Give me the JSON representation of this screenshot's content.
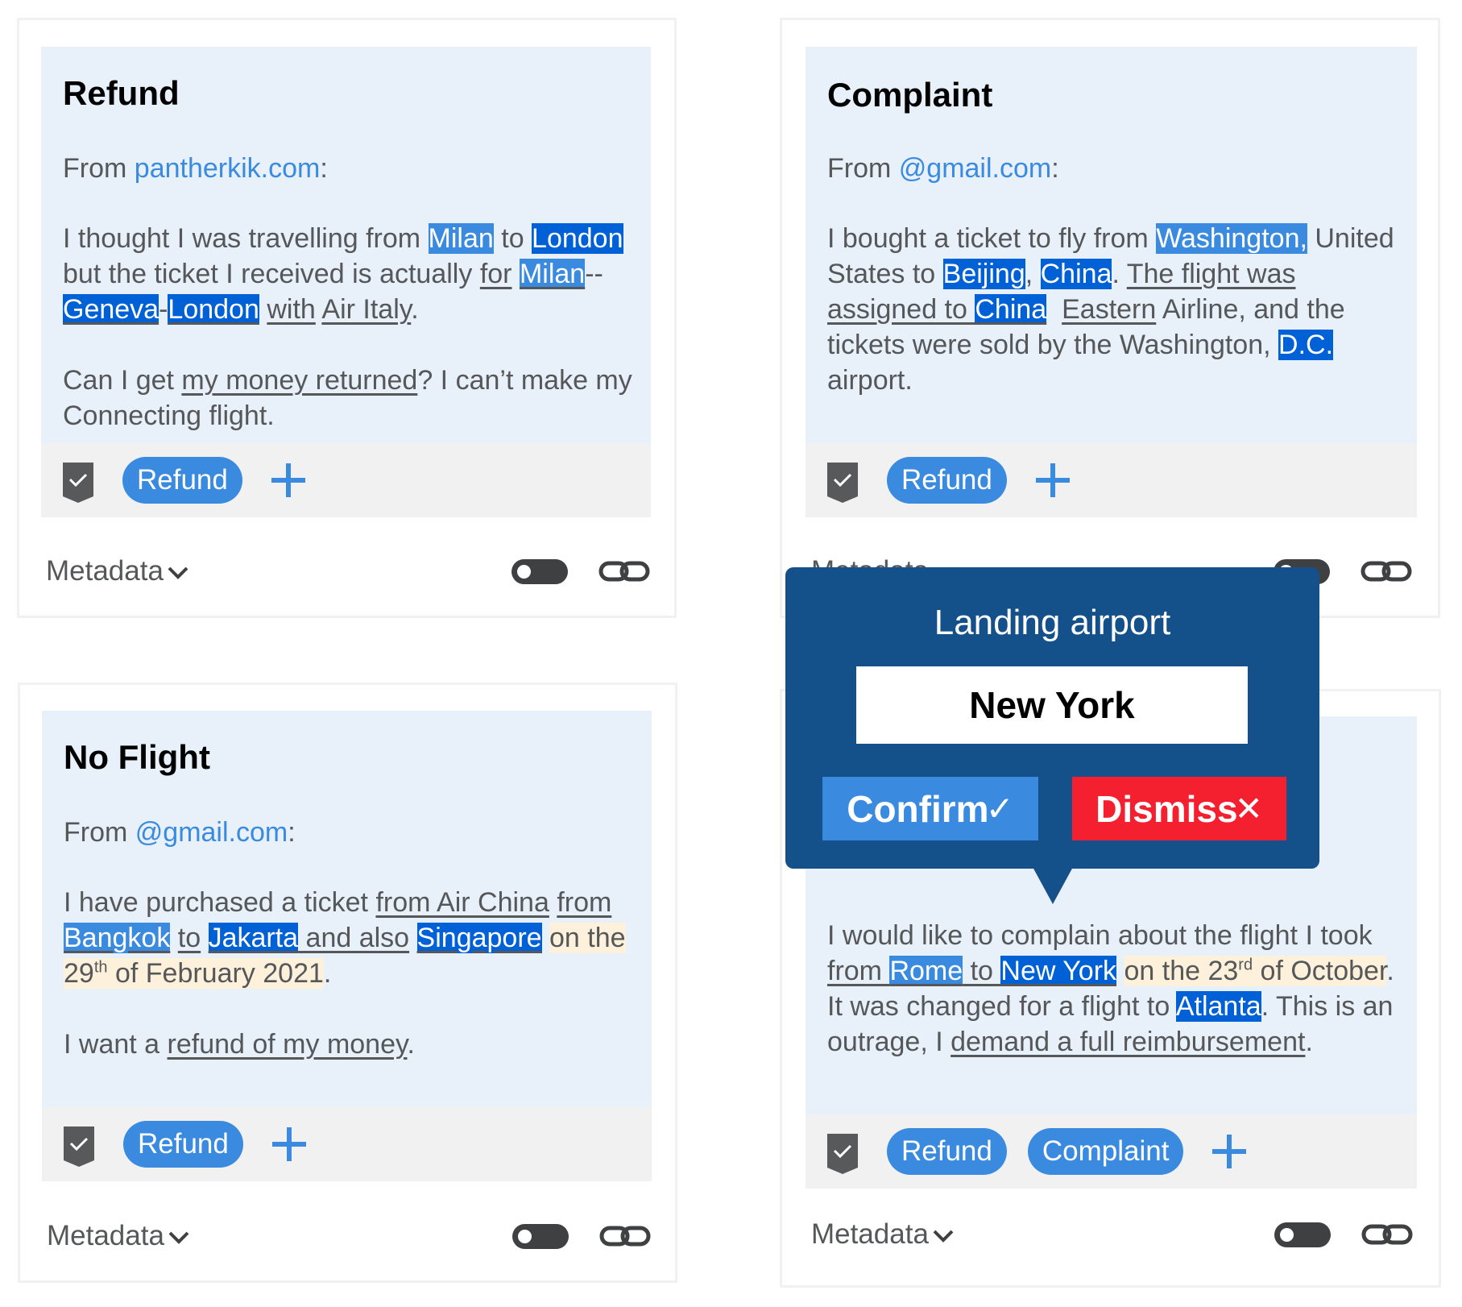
{
  "colors": {
    "accent": "#3a8be0",
    "entity_dark": "#0060d6",
    "date_highlight": "#fdf1dc",
    "panel_bg": "#e8f0fa",
    "popup_bg": "#14508a",
    "dismiss": "#f5202f"
  },
  "cards": [
    {
      "title": "Refund",
      "from_label": "From ",
      "from_email": "pantherkik.com",
      "from_suffix": ":",
      "labels": [
        "Refund"
      ],
      "metadata_label": "Metadata",
      "toggle_on": false
    },
    {
      "title": "Complaint",
      "from_label": "From ",
      "from_email": "@gmail.com",
      "from_suffix": ":",
      "labels": [
        "Refund"
      ],
      "metadata_label": "Metadata",
      "toggle_on": false
    },
    {
      "title": "No Flight",
      "from_label": "From ",
      "from_email": "@gmail.com",
      "from_suffix": ":",
      "labels": [
        "Refund"
      ],
      "metadata_label": "Metadata",
      "toggle_on": false
    },
    {
      "title": "",
      "labels": [
        "Refund",
        "Complaint"
      ],
      "metadata_label": "Metadata",
      "toggle_on": false
    }
  ],
  "text": {
    "c1": {
      "t1": "I thought I was travelling from ",
      "milan1": "Milan",
      "t2": " to ",
      "london1": "London ",
      "t3": "but the ticket I received is actually ",
      "for": "for",
      "sp1": " ",
      "milan2": "Milan",
      "dash1": "--",
      "geneva": "Geneva",
      "dash2": "-",
      "london2": "London",
      "sp2": " ",
      "with": "with",
      "sp3": " ",
      "airitaly": "Air Italy",
      "dot": ".",
      "p2a": "Can I get ",
      "money": "my money returned",
      "p2b": "? I can’t make my Connecting flight."
    },
    "c2": {
      "t1": "I bought a ticket to fly from ",
      "wash": "Washington,",
      "t2": " United States to ",
      "beijing": "Beijing",
      "comma": ", ",
      "china1": "China",
      "dot1": ". ",
      "flight": "The flight was assigned to ",
      "china2": "China",
      "sp": "  ",
      "eastern": "Eastern",
      "t3": " Airline, and the tickets were sold by the Washington, ",
      "dc": "D.C.",
      "t4": " airport."
    },
    "c3": {
      "t1": "I have purchased a ticket ",
      "airchina": "from Air China",
      "sp1": " ",
      "from": "from ",
      "bangkok": "Bangkok",
      "sp2": " ",
      "to": "to",
      "sp3": " ",
      "jakarta": "Jakarta",
      "andalso": " and also",
      "sp4": " ",
      "singapore": "Singapore",
      "sp5": " ",
      "date_a": "on the 29",
      "date_sup": "th",
      "date_b": " of February 2021",
      "dot": ".",
      "p2a": "I want a ",
      "refund": "refund of my money",
      "p2b": "."
    },
    "c4": {
      "t1": "I would like to complain about the flight I took ",
      "from": "from ",
      "rome": "Rome",
      "to": " to ",
      "newyork": "New York",
      "sp1": " ",
      "date_a": "on the 23",
      "date_sup": "rd",
      "date_b": " of October",
      "t2": ". It was changed for a flight to ",
      "atlanta": "Atlanta",
      "t3": ". This is an outrage, I ",
      "demand": "demand a full reimbursement",
      "dot": "."
    }
  },
  "popup": {
    "title": "Landing airport",
    "input_value": "New York",
    "confirm_label": "Confirm",
    "confirm_icon": "✓",
    "dismiss_label": "Dismiss",
    "dismiss_icon": "✕"
  },
  "icons": {
    "label": "bookmark-check-icon",
    "add": "plus-icon",
    "metadata_expand": "chevron-down-icon",
    "toggle": "toggle-switch",
    "link": "link-icon"
  }
}
